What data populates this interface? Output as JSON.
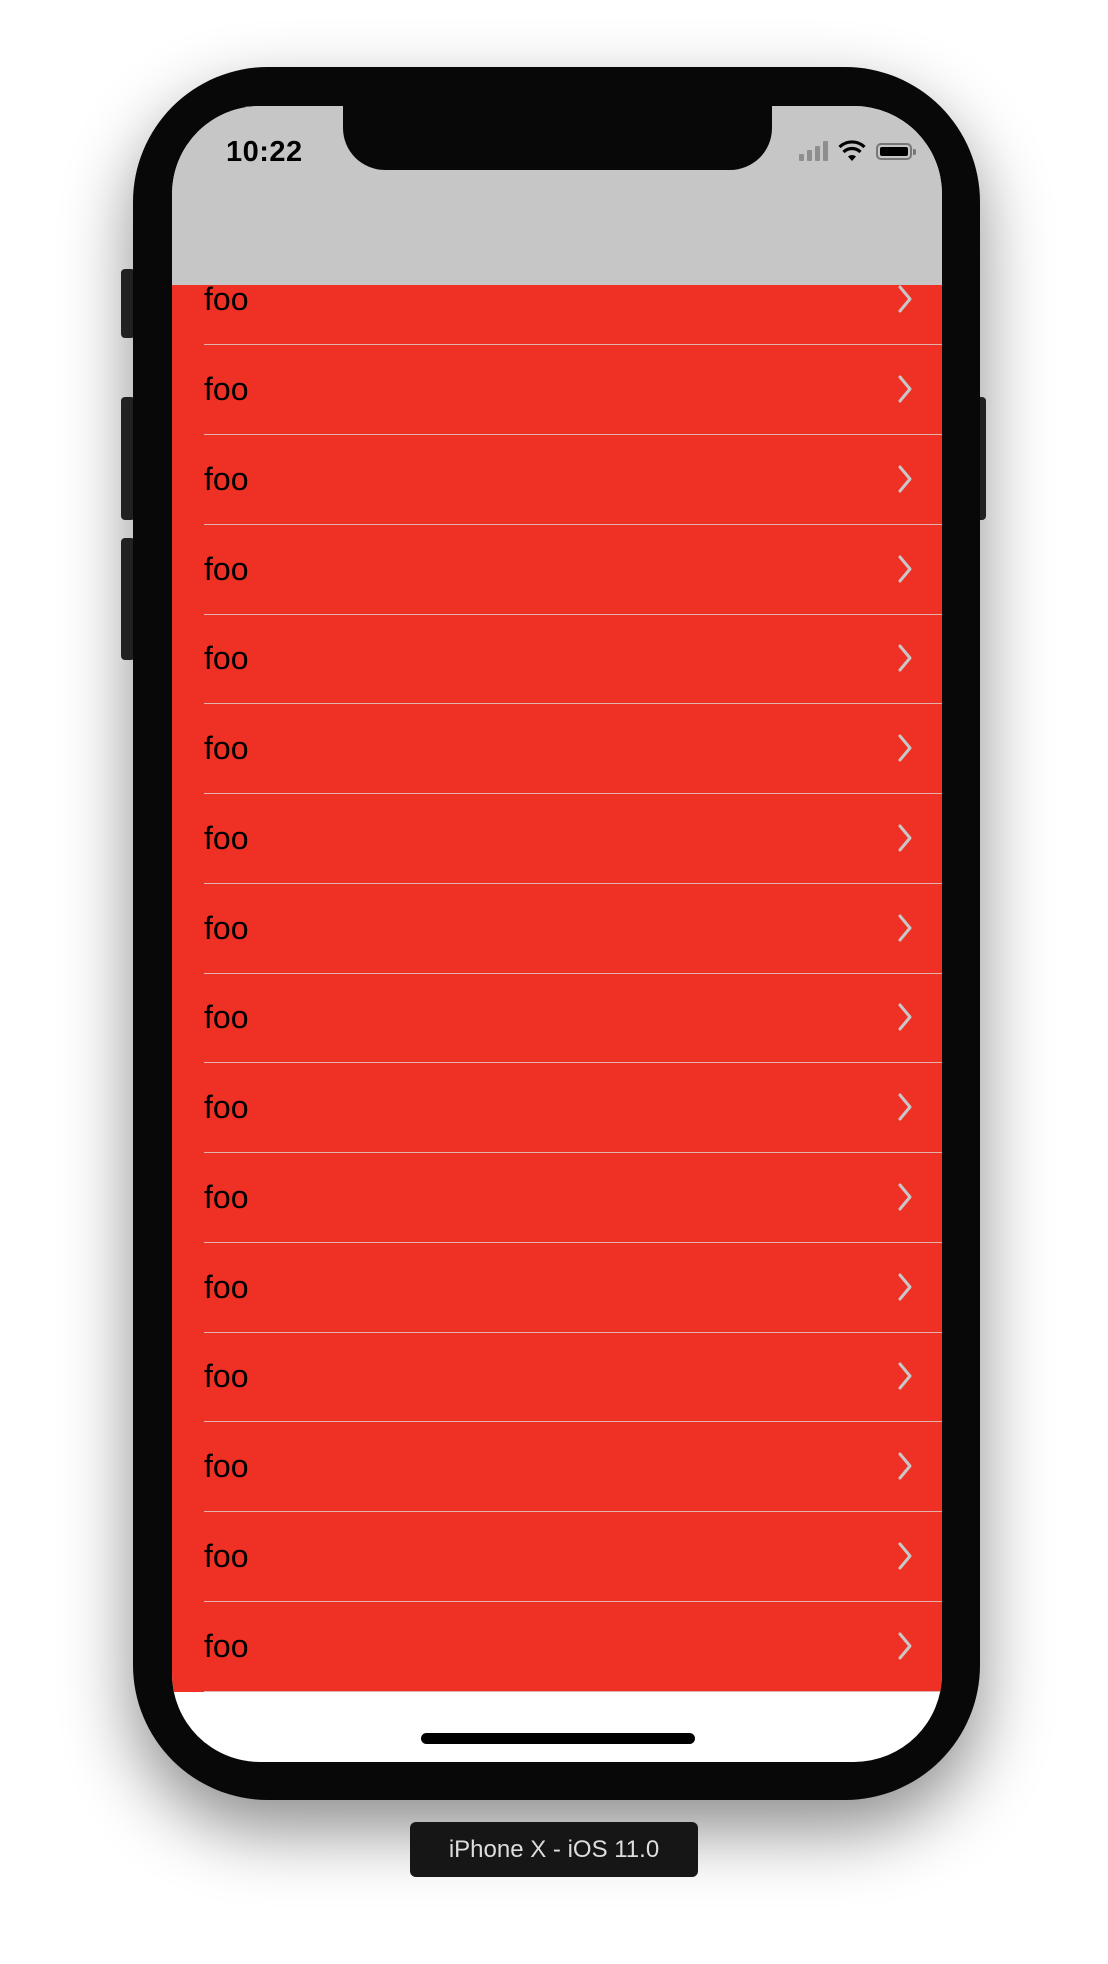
{
  "status_bar": {
    "time": "10:22",
    "icons": [
      "cellular-signal-icon",
      "wifi-icon",
      "battery-icon"
    ]
  },
  "list": {
    "items": [
      {
        "label": "foo"
      },
      {
        "label": "foo"
      },
      {
        "label": "foo"
      },
      {
        "label": "foo"
      },
      {
        "label": "foo"
      },
      {
        "label": "foo"
      },
      {
        "label": "foo"
      },
      {
        "label": "foo"
      },
      {
        "label": "foo"
      },
      {
        "label": "foo"
      },
      {
        "label": "foo"
      },
      {
        "label": "foo"
      },
      {
        "label": "foo"
      },
      {
        "label": "foo"
      },
      {
        "label": "foo"
      },
      {
        "label": "foo"
      }
    ],
    "accessory_icon": "chevron-right-icon"
  },
  "device_label": "iPhone X - iOS 11.0",
  "colors": {
    "row_background": "#ee3124",
    "navbar_background": "#c6c6c6",
    "chevron": "#c8c8c8",
    "device_frame": "#080808"
  }
}
